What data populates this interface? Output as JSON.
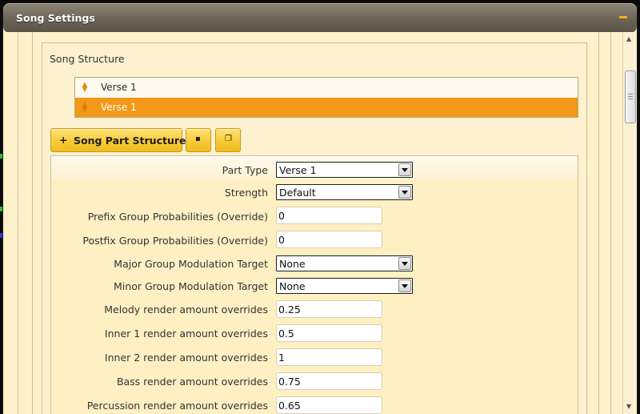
{
  "window": {
    "title": "Song Settings"
  },
  "group": {
    "title": "Song Structure"
  },
  "structure_list": [
    {
      "label": "Verse 1",
      "selected": false
    },
    {
      "label": "Verse 1",
      "selected": true
    }
  ],
  "toolbar": {
    "add_label": "Song Part Structure",
    "add_icon": "plus-icon",
    "delete_icon": "trash-icon",
    "copy_icon": "copy-icon"
  },
  "form": {
    "part_type": {
      "label": "Part Type",
      "value": "Verse 1"
    },
    "strength": {
      "label": "Strength",
      "value": "Default"
    },
    "prefix_group": {
      "label": "Prefix Group Probabilities (Override)",
      "value": "0"
    },
    "postfix_group": {
      "label": "Postfix Group Probabilities (Override)",
      "value": "0"
    },
    "major_modulation": {
      "label": "Major Group Modulation Target",
      "value": "None"
    },
    "minor_modulation": {
      "label": "Minor Group Modulation Target",
      "value": "None"
    },
    "melody_render": {
      "label": "Melody render amount overrides",
      "value": "0.25"
    },
    "inner1_render": {
      "label": "Inner 1 render amount overrides",
      "value": "0.5"
    },
    "inner2_render": {
      "label": "Inner 2 render amount overrides",
      "value": "1"
    },
    "bass_render": {
      "label": "Bass render amount overrides",
      "value": "0.75"
    },
    "percussion_render": {
      "label": "Percussion render amount overrides",
      "value": "0.65"
    }
  },
  "colors": {
    "accent": "#f39817",
    "button": "#f7c934",
    "panel": "#fff2cb"
  }
}
